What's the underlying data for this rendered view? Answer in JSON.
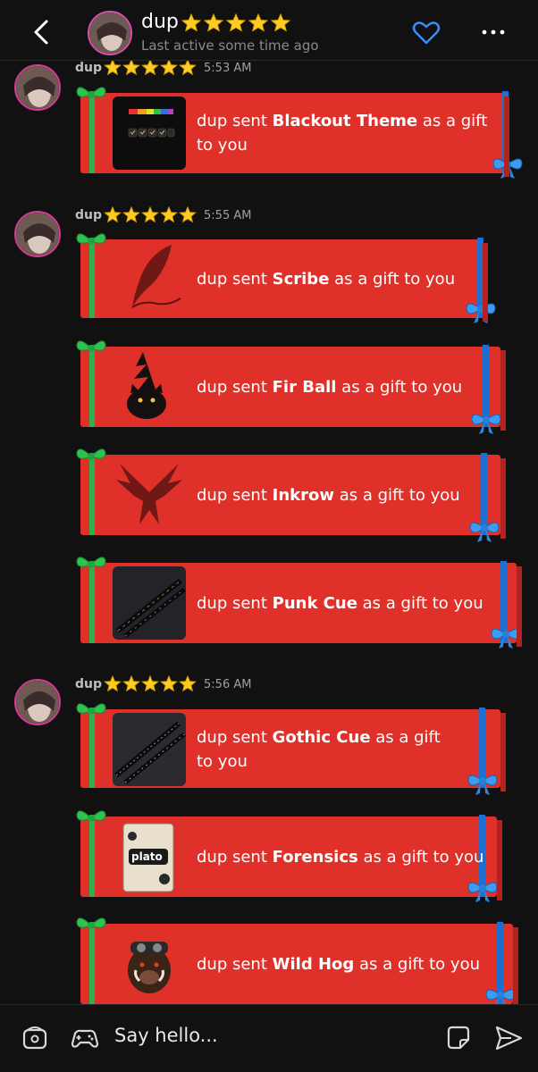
{
  "header": {
    "name": "dup",
    "subtitle": "Last active some time ago",
    "star_count": 5
  },
  "messages": [
    {
      "sender": "dup",
      "time": "5:53 AM",
      "gifts": [
        {
          "prefix": "dup sent ",
          "item": "Blackout Theme",
          "suffix": " as a gift",
          "line2": "to you",
          "thumb": "blackout-theme-thumbnail"
        }
      ]
    },
    {
      "sender": "dup",
      "time": "5:55 AM",
      "gifts": [
        {
          "prefix": "dup sent ",
          "item": "Scribe",
          "suffix": " as a gift to you",
          "thumb": "quill-icon"
        },
        {
          "prefix": "dup sent ",
          "item": "Fir Ball",
          "suffix": " as a gift to you",
          "thumb": "black-cat-icon"
        },
        {
          "prefix": "dup sent ",
          "item": "Inkrow",
          "suffix": " as a gift to you",
          "thumb": "crow-icon"
        },
        {
          "prefix": "dup sent ",
          "item": "Punk Cue",
          "suffix": " as a gift to you",
          "thumb": "cue-thumbnail"
        }
      ]
    },
    {
      "sender": "dup",
      "time": "5:56 AM",
      "gifts": [
        {
          "prefix": "dup sent ",
          "item": "Gothic Cue",
          "suffix": " as a gift",
          "line2": "to you",
          "thumb": "cue-thumbnail"
        },
        {
          "prefix": "dup sent ",
          "item": "Forensics",
          "suffix": " as a gift to you",
          "thumb": "plato-card-thumbnail"
        },
        {
          "prefix": "dup sent ",
          "item": "Wild Hog",
          "suffix": " as a gift to you",
          "thumb": "boar-icon"
        }
      ]
    }
  ],
  "plato_label": "plato",
  "composer": {
    "placeholder": "Say hello..."
  },
  "colors": {
    "card_red": "#e0302a",
    "ribbon_green": "#2bb24c",
    "ribbon_blue": "#1d6fd1",
    "heart_blue": "#3a8ef5",
    "background": "#111112"
  }
}
